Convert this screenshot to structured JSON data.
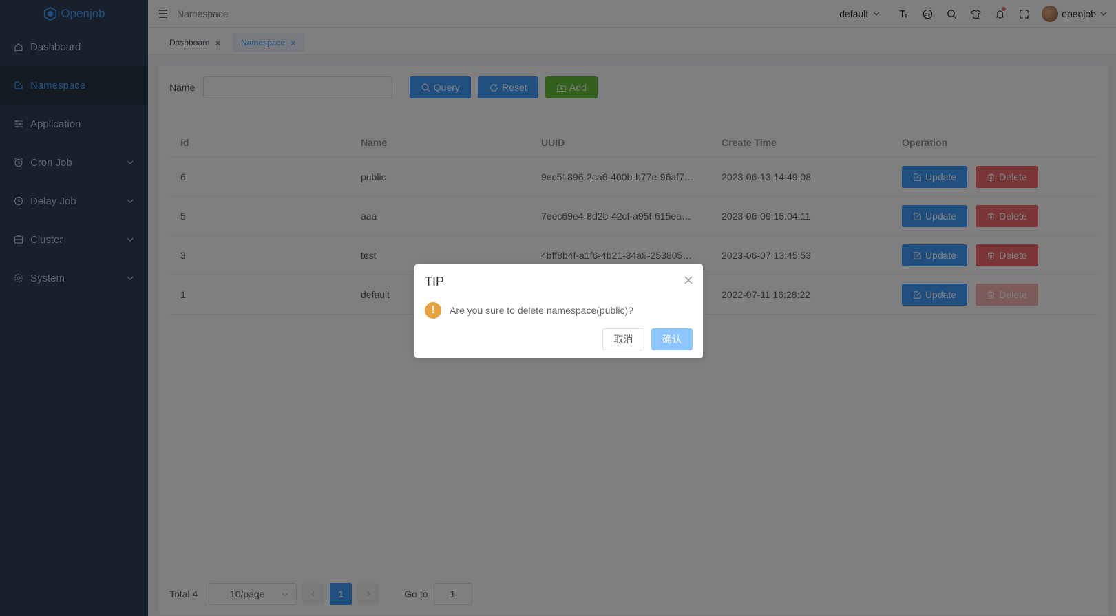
{
  "app": {
    "logo_text": "Openjob"
  },
  "sidebar": {
    "items": [
      {
        "label": "Dashboard",
        "icon": "home-icon",
        "active": false,
        "expandable": false
      },
      {
        "label": "Namespace",
        "icon": "edit-icon",
        "active": true,
        "expandable": false
      },
      {
        "label": "Application",
        "icon": "sliders-icon",
        "active": false,
        "expandable": false
      },
      {
        "label": "Cron Job",
        "icon": "alarm-clock-icon",
        "active": false,
        "expandable": true
      },
      {
        "label": "Delay Job",
        "icon": "clock-icon",
        "active": false,
        "expandable": true
      },
      {
        "label": "Cluster",
        "icon": "cluster-icon",
        "active": false,
        "expandable": true
      },
      {
        "label": "System",
        "icon": "gear-icon",
        "active": false,
        "expandable": true
      }
    ]
  },
  "header": {
    "breadcrumb": "Namespace",
    "namespace_select": "default",
    "username": "openjob"
  },
  "tags": [
    {
      "label": "Dashboard",
      "active": false
    },
    {
      "label": "Namespace",
      "active": true
    }
  ],
  "search": {
    "name_label": "Name",
    "name_value": "",
    "query_label": "Query",
    "reset_label": "Reset",
    "add_label": "Add"
  },
  "table": {
    "columns": [
      "id",
      "Name",
      "UUID",
      "Create Time",
      "Operation"
    ],
    "rows": [
      {
        "id": "6",
        "name": "public",
        "uuid": "9ec51896-2ca6-400b-b77e-96af7…",
        "create_time": "2023-06-13 14:49:08",
        "delete_disabled": false
      },
      {
        "id": "5",
        "name": "aaa",
        "uuid": "7eec69e4-8d2b-42cf-a95f-615ea…",
        "create_time": "2023-06-09 15:04:11",
        "delete_disabled": false
      },
      {
        "id": "3",
        "name": "test",
        "uuid": "4bff8b4f-a1f6-4b21-84a8-253805…",
        "create_time": "2023-06-07 13:45:53",
        "delete_disabled": false
      },
      {
        "id": "1",
        "name": "default",
        "uuid": "",
        "create_time": "2022-07-11 16:28:22",
        "delete_disabled": true
      }
    ],
    "update_label": "Update",
    "delete_label": "Delete"
  },
  "pagination": {
    "total_text": "Total 4",
    "page_size": "10/page",
    "current_page": "1",
    "goto_label": "Go to",
    "goto_value": "1"
  },
  "dialog": {
    "title": "TIP",
    "message": "Are you sure to delete namespace(public)?",
    "cancel_label": "取消",
    "confirm_label": "确认"
  },
  "colors": {
    "sidebar_bg": "#304156",
    "primary": "#409eff",
    "success": "#67c23a",
    "danger": "#f56c6c",
    "warning": "#e6a23c"
  }
}
